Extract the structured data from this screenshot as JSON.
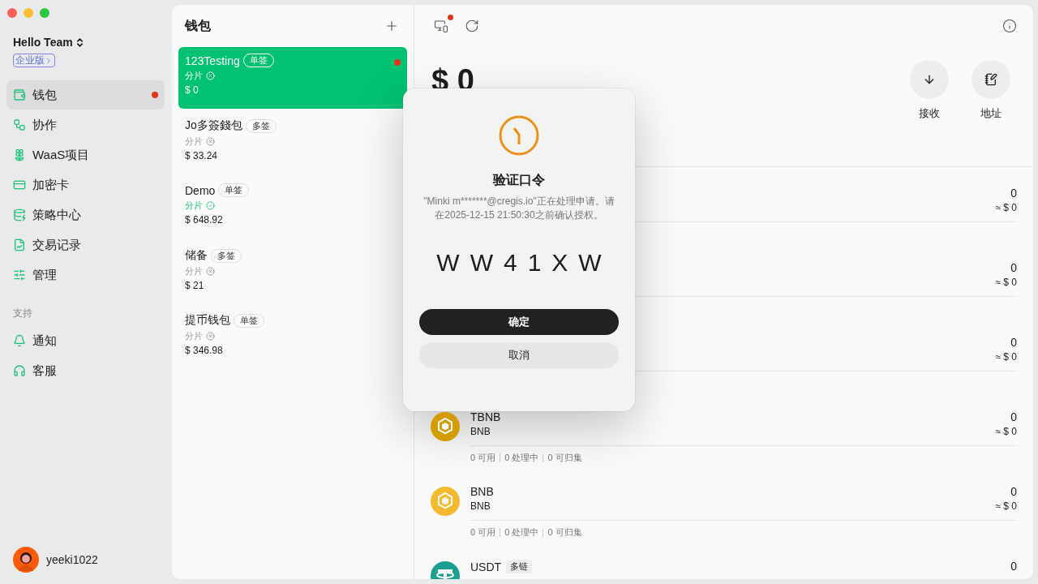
{
  "sidebar": {
    "team": "Hello Team",
    "plan": "企业版",
    "nav": [
      {
        "label": "钱包",
        "selected": true,
        "alert": true
      },
      {
        "label": "协作",
        "selected": false,
        "alert": false
      },
      {
        "label": "WaaS项目",
        "selected": false,
        "alert": false
      },
      {
        "label": "加密卡",
        "selected": false,
        "alert": false
      },
      {
        "label": "策略中心",
        "selected": false,
        "alert": false
      },
      {
        "label": "交易记录",
        "selected": false,
        "alert": false
      },
      {
        "label": "管理",
        "selected": false,
        "alert": false
      }
    ],
    "support_heading": "支持",
    "support": [
      {
        "label": "通知",
        "selected": false,
        "alert": false
      },
      {
        "label": "客服",
        "selected": false,
        "alert": false
      }
    ],
    "user": "yeeki1022"
  },
  "wallets": {
    "title": "钱包",
    "items": [
      {
        "name": "123Testing",
        "tag": "单签",
        "shard": "分片",
        "shard_ok": false,
        "balance": "$ 0",
        "selected": true,
        "alert": true
      },
      {
        "name": "Jo多簽錢包",
        "tag": "多签",
        "shard": "分片",
        "shard_ok": false,
        "balance": "$ 33.24",
        "selected": false,
        "alert": false
      },
      {
        "name": "Demo",
        "tag": "单签",
        "shard": "分片",
        "shard_ok": true,
        "balance": "$ 648.92",
        "selected": false,
        "alert": false
      },
      {
        "name": "储备",
        "tag": "多签",
        "shard": "分片",
        "shard_ok": false,
        "balance": "$ 21",
        "selected": false,
        "alert": false
      },
      {
        "name": "提币钱包",
        "tag": "单签",
        "shard": "分片",
        "shard_ok": false,
        "balance": "$ 346.98",
        "selected": false,
        "alert": false
      }
    ]
  },
  "main": {
    "notification_alert": true,
    "balance": "$ 0",
    "actions": [
      {
        "label": "接收",
        "kind": "receive"
      },
      {
        "label": "地址",
        "kind": "address"
      }
    ],
    "assets": [
      {
        "amount": "0",
        "value": "≈ $ 0"
      },
      {
        "amount": "0",
        "value": "≈ $ 0"
      },
      {
        "amount": "0",
        "value": "≈ $ 0"
      },
      {
        "kind": "bnb",
        "color": "#d39c00",
        "name": "TBNB",
        "network": "BNB",
        "amount": "0",
        "value": "≈ $ 0",
        "stats": [
          "0 可用",
          "0 处理中",
          "0 可归集"
        ]
      },
      {
        "kind": "bnb",
        "color": "#f3ba2f",
        "name": "BNB",
        "network": "BNB",
        "amount": "0",
        "value": "≈ $ 0",
        "stats": [
          "0 可用",
          "0 处理中",
          "0 可归集"
        ]
      },
      {
        "kind": "usdt",
        "color": "#1a9e8f",
        "name": "USDT",
        "tag": "多链",
        "amount": "0"
      }
    ]
  },
  "dialog": {
    "title": "验证口令",
    "message": "\"Minki m*******@cregis.io\"正在处理申请。请在2025-12-15 21:50:30之前确认授权。",
    "code": "WW41XW",
    "confirm": "确定",
    "cancel": "取消"
  }
}
